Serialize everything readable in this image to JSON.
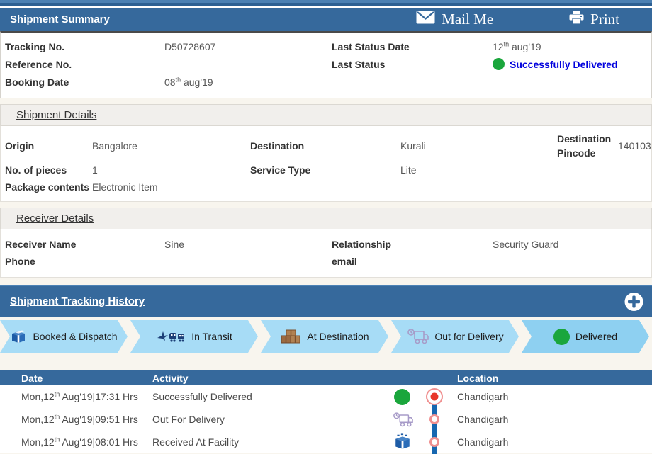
{
  "header": {
    "title": "Shipment Summary",
    "mail_label": "Mail Me",
    "print_label": "Print"
  },
  "summary": {
    "tracking_label": "Tracking No.",
    "tracking_value": "D50728607",
    "reference_label": "Reference No.",
    "reference_value": "",
    "booking_label": "Booking Date",
    "booking_date": {
      "prefix": "08",
      "sup": "th",
      "rest": " aug'19"
    },
    "last_status_date_label": "Last Status Date",
    "last_status_date": {
      "prefix": "12",
      "sup": "th",
      "rest": " aug'19"
    },
    "last_status_label": "Last Status",
    "last_status_value": "Successfully Delivered"
  },
  "shipment_details": {
    "title": "Shipment Details",
    "origin_label": "Origin",
    "origin_value": "Bangalore",
    "destination_label": "Destination",
    "destination_value": "Kurali",
    "dest_pincode_label": "Destination Pincode",
    "dest_pincode_value": "140103",
    "pieces_label": "No. of pieces",
    "pieces_value": "1",
    "service_label": "Service Type",
    "service_value": "Lite",
    "contents_label": "Package contents",
    "contents_value": "Electronic Item"
  },
  "receiver_details": {
    "title": "Receiver Details",
    "name_label": "Receiver Name",
    "name_value": "Sine",
    "relationship_label": "Relationship",
    "relationship_value": "Security Guard",
    "phone_label": "Phone",
    "phone_value": "",
    "email_label": "email",
    "email_value": ""
  },
  "tracking_history": {
    "title": "Shipment Tracking History",
    "add_icon": "plus-icon",
    "stages": [
      {
        "label": "Booked & Dispatch",
        "icon": "package-icon"
      },
      {
        "label": "In Transit",
        "icon": "transit-icon"
      },
      {
        "label": "At Destination",
        "icon": "boxes-icon"
      },
      {
        "label": "Out for Delivery",
        "icon": "truck-icon"
      },
      {
        "label": "Delivered",
        "icon": "green-dot-icon"
      }
    ],
    "table": {
      "columns": [
        "Date",
        "Activity",
        "Location"
      ],
      "rows": [
        {
          "date": {
            "prefix": "Mon,12",
            "sup": "th",
            "rest": " Aug'19|17:31 Hrs"
          },
          "activity": "Successfully Delivered",
          "location": "Chandigarh",
          "icon": "green-dot-icon",
          "node": "current"
        },
        {
          "date": {
            "prefix": "Mon,12",
            "sup": "th",
            "rest": " Aug'19|09:51 Hrs"
          },
          "activity": "Out For Delivery",
          "location": "Chandigarh",
          "icon": "truck-icon",
          "node": "past"
        },
        {
          "date": {
            "prefix": "Mon,12",
            "sup": "th",
            "rest": " Aug'19|08:01 Hrs"
          },
          "activity": "Received At Facility",
          "location": "Chandigarh",
          "icon": "package-icon",
          "node": "past"
        }
      ]
    }
  },
  "colors": {
    "header_blue": "#36699c",
    "chevron_blue": "#a7dcf6",
    "chevron_blue_active": "#8ed0f1",
    "status_link_blue": "#0000dd",
    "delivered_green": "#1aa63c",
    "timeline_blue": "#1767b0",
    "timeline_red": "#e8372b",
    "timeline_ring": "#f09090",
    "page_background": "#f8f5ee"
  }
}
